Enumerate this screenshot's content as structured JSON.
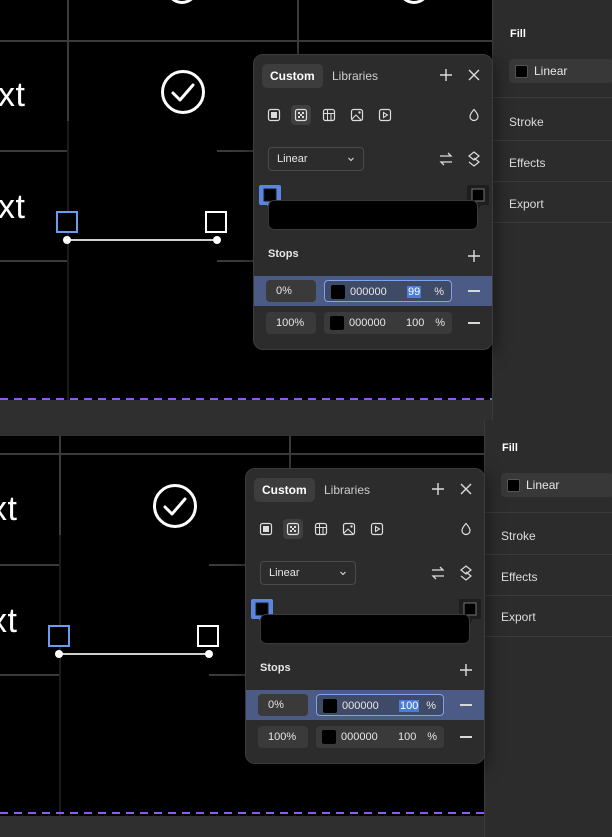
{
  "canvas": {
    "text_fragment": "xt",
    "accent_dashed_color": "#8b5cf6"
  },
  "panels": [
    {
      "right": {
        "fill_title": "Fill",
        "fill_type": "Linear",
        "items": [
          "Stroke",
          "Effects",
          "Export"
        ]
      },
      "popup": {
        "tabs": [
          "Custom",
          "Libraries"
        ],
        "type_select": "Linear",
        "stops_label": "Stops",
        "stops": [
          {
            "position": "0%",
            "hex": "000000",
            "alpha": "99",
            "pct": "%"
          },
          {
            "position": "100%",
            "hex": "000000",
            "alpha": "100",
            "pct": "%"
          }
        ]
      }
    },
    {
      "right": {
        "fill_title": "Fill",
        "fill_type": "Linear",
        "items": [
          "Stroke",
          "Effects",
          "Export"
        ]
      },
      "popup": {
        "tabs": [
          "Custom",
          "Libraries"
        ],
        "type_select": "Linear",
        "stops_label": "Stops",
        "stops": [
          {
            "position": "0%",
            "hex": "000000",
            "alpha": "100",
            "pct": "%"
          },
          {
            "position": "100%",
            "hex": "000000",
            "alpha": "100",
            "pct": "%"
          }
        ]
      }
    }
  ],
  "icons": [
    "solid-fill-icon",
    "gradient-fill-icon",
    "pattern-fill-icon",
    "image-fill-icon",
    "video-fill-icon",
    "opacity-drop-icon",
    "add-icon",
    "close-icon",
    "flip-gradient-icon",
    "rotate-gradient-icon",
    "remove-stop-icon",
    "check-circle-icon"
  ]
}
